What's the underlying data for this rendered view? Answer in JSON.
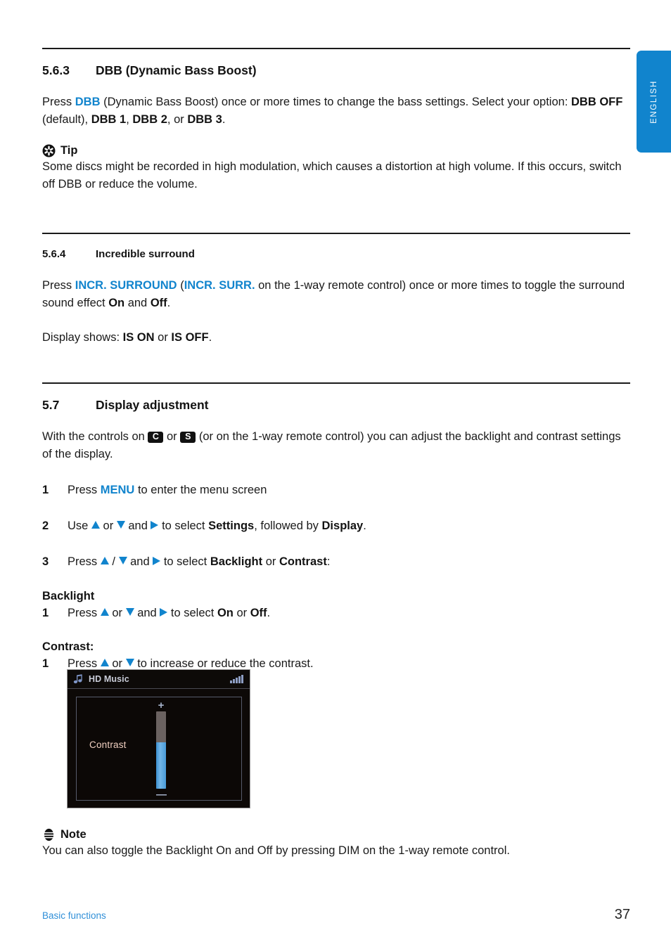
{
  "language_tab": {
    "label": "ENGLISH",
    "color": "#1184cd"
  },
  "accent_color": "#1184cd",
  "sections": {
    "dbb": {
      "number": "5.6.3",
      "title": "DBB (Dynamic Bass Boost)",
      "para_1_a": "Press ",
      "para_1_key": "DBB",
      "para_1_b": " (Dynamic Bass Boost) once or more times to change the bass settings. Select your option: ",
      "opt_off": "DBB OFF",
      "para_1_c": " (default), ",
      "opt_1": "DBB 1",
      "para_1_d": ", ",
      "opt_2": "DBB 2",
      "para_1_e": ", or ",
      "opt_3": "DBB 3",
      "para_1_f": "."
    },
    "tip": {
      "icon": "tip-asterisk-icon",
      "label": "Tip",
      "text": "Some discs might be recorded in high modulation, which causes a distortion at high volume. If this occurs, switch off DBB or reduce the volume."
    },
    "surround": {
      "number": "5.6.4",
      "title": "Incredible surround",
      "para_a": "Press ",
      "key_1": "INCR. SURROUND",
      "para_b": " (",
      "key_2": "INCR. SURR.",
      "para_c": " on the 1-way remote control) once or more times to toggle the surround sound effect ",
      "on": "On",
      "para_d": " and ",
      "off": "Off",
      "para_e": ".",
      "display_a": "Display shows: ",
      "display_on": "IS ON",
      "display_b": " or ",
      "display_off": "IS OFF",
      "display_c": "."
    },
    "display_adjustment": {
      "number": "5.7",
      "title": "Display adjustment",
      "intro_a": "With the controls on ",
      "badge_c": "C",
      "intro_b": " or ",
      "badge_s": "S",
      "intro_c": " (or on the 1-way remote control) you can adjust the backlight and contrast settings of the display.",
      "steps": [
        {
          "num": "1",
          "a": "Press ",
          "key": "MENU",
          "b": " to enter the menu screen"
        },
        {
          "num": "2",
          "a": "Use ",
          "b": " or ",
          "c": " and ",
          "d": " to select ",
          "bold_1": "Settings",
          "e": ", followed by ",
          "bold_2": "Display",
          "f": "."
        },
        {
          "num": "3",
          "a": "Press ",
          "b": " / ",
          "c": " and ",
          "d": " to select ",
          "bold_1": "Backlight",
          "e": " or ",
          "bold_2": "Contrast",
          "f": ":"
        }
      ],
      "backlight": {
        "heading": "Backlight",
        "num": "1",
        "a": "Press ",
        "b": " or ",
        "c": " and ",
        "d": " to select ",
        "bold_1": "On",
        "e": " or ",
        "bold_2": "Off",
        "f": "."
      },
      "contrast": {
        "heading": "Contrast:",
        "num": "1",
        "a": "Press ",
        "b": " or ",
        "c": " to increase or reduce the contrast."
      }
    },
    "note": {
      "icon": "note-lines-icon",
      "label": "Note",
      "text": "You can also toggle the Backlight On and Off by pressing DIM on the 1-way remote control."
    }
  },
  "device_screenshot": {
    "music_note_icon": "music-note-icon",
    "title": "HD Music",
    "signal_icon": "signal-bars-icon",
    "setting_label": "Contrast",
    "plus_label": "+",
    "minus_label": "—",
    "slider_fill_percent": 60
  },
  "footer": {
    "chapter": "Basic functions",
    "page_number": "37"
  }
}
